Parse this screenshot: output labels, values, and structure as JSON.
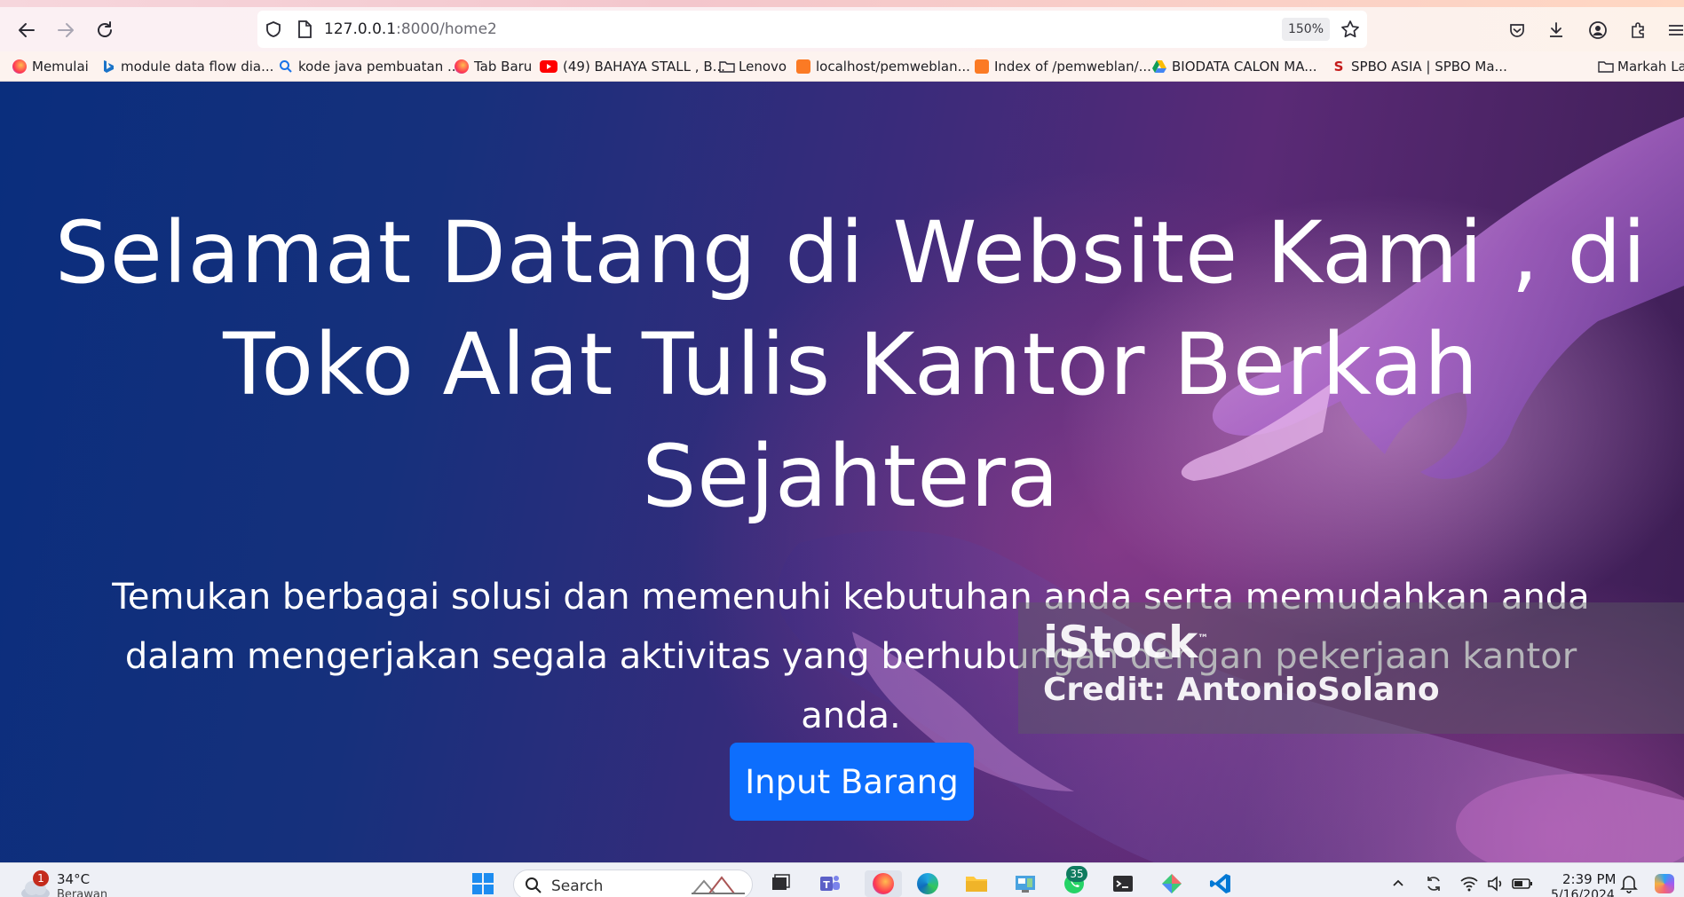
{
  "browser": {
    "url_host": "127.0.0.1",
    "url_rest": ":8000/home2",
    "zoom": "150%",
    "bookmarks": [
      {
        "label": "Memulai",
        "icon": "firefox-icon"
      },
      {
        "label": "module data flow dia...",
        "icon": "bing-icon"
      },
      {
        "label": "kode java pembuatan ...",
        "icon": "search-icon"
      },
      {
        "label": "Tab Baru",
        "icon": "firefox-icon"
      },
      {
        "label": "(49) BAHAYA STALL , B...",
        "icon": "youtube-icon"
      },
      {
        "label": "Lenovo",
        "icon": "folder-icon"
      },
      {
        "label": "localhost/pemweblan...",
        "icon": "xampp-icon"
      },
      {
        "label": "Index of /pemweblan/...",
        "icon": "xampp-icon"
      },
      {
        "label": "BIODATA CALON MA...",
        "icon": "google-drive-icon"
      },
      {
        "label": "SPBO ASIA | SPBO Ma...",
        "icon": "spbo-icon"
      },
      {
        "label": "Markah Lai",
        "icon": "folder-icon"
      }
    ]
  },
  "hero": {
    "title": "Selamat Datang di Website Kami , di Toko Alat Tulis Kantor Berkah Sejahtera",
    "subtitle": "Temukan berbagai solusi dan memenuhi kebutuhan anda serta memudahkan anda dalam mengerjakan segala aktivitas yang berhubungan dengan pekerjaan kantor anda.",
    "button_label": "Input Barang",
    "watermark_brand": "iStock",
    "watermark_tm": "™",
    "watermark_credit": "Credit: AntonioSolano"
  },
  "taskbar": {
    "weather_badge": "1",
    "temperature": "34°C",
    "weather_desc": "Berawan",
    "search_label": "Search",
    "whatsapp_badge": "35",
    "time": "2:39 PM",
    "date": "5/16/2024"
  },
  "colors": {
    "primary_button": "#0d6efd",
    "hero_gradient_start": "#0a2e7d",
    "hero_gradient_end": "#5a2a76"
  }
}
